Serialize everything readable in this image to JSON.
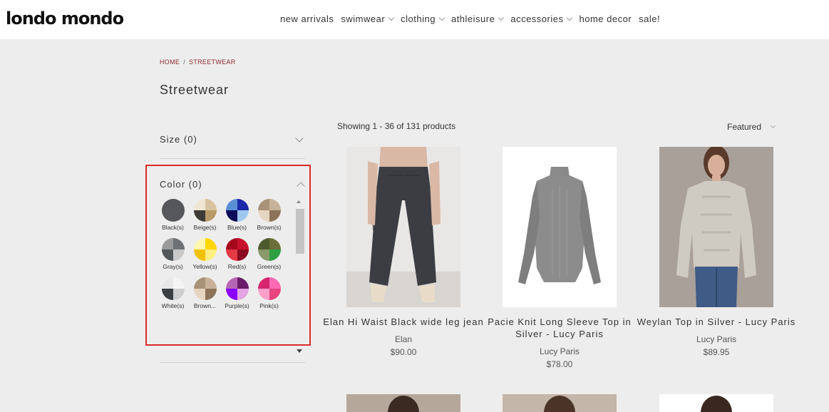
{
  "header": {
    "logo": "londo mondo",
    "nav": [
      {
        "label": "new arrivals",
        "dropdown": false
      },
      {
        "label": "swimwear",
        "dropdown": true
      },
      {
        "label": "clothing",
        "dropdown": true
      },
      {
        "label": "athleisure",
        "dropdown": true
      },
      {
        "label": "accessories",
        "dropdown": true
      },
      {
        "label": "home decor",
        "dropdown": false
      },
      {
        "label": "sale!",
        "dropdown": false
      }
    ]
  },
  "breadcrumb": {
    "home": "HOME",
    "separator": "/",
    "current": "STREETWEAR"
  },
  "page_title": "Streetwear",
  "filters": {
    "size_label": "Size (0)",
    "color_label": "Color (0)",
    "colors": [
      {
        "label": "Black(s)",
        "fills": [
          "#55575a"
        ]
      },
      {
        "label": "Beige(s)",
        "fills": [
          "#d8c2a0",
          "#b89a6a",
          "#3e3a35",
          "#efe6d5"
        ]
      },
      {
        "label": "Blue(s)",
        "fills": [
          "#1b2aa8",
          "#9ec7ef",
          "#0b0b5a",
          "#5a8fd6"
        ]
      },
      {
        "label": "Brown(s)",
        "fills": [
          "#c7b299",
          "#8c735a",
          "#e5d5c0",
          "#a89278"
        ]
      },
      {
        "label": "Gray(s)",
        "fills": [
          "#6e7275",
          "#c9c9c9",
          "#52575a",
          "#9a9a9a"
        ]
      },
      {
        "label": "Yellow(s)",
        "fills": [
          "#ffd500",
          "#ffef80",
          "#f2c200",
          "#fff6b0"
        ]
      },
      {
        "label": "Red(s)",
        "fills": [
          "#c8102e",
          "#8a0a1f",
          "#e63946",
          "#a5081b"
        ]
      },
      {
        "label": "Green(s)",
        "fills": [
          "#6a6f3a",
          "#2ea043",
          "#8a9a6a",
          "#4e5a2e"
        ]
      },
      {
        "label": "White(s)",
        "fills": [
          "#f5f5f5",
          "#cfcfcf",
          "#3a3f44",
          "#e8e8e8"
        ]
      },
      {
        "label": "Brown...",
        "fills": [
          "#c7b299",
          "#8c735a",
          "#e5d5c0",
          "#a89278"
        ]
      },
      {
        "label": "Purple(s)",
        "fills": [
          "#6a1b6a",
          "#e3a6e3",
          "#8b00ff",
          "#b565b5"
        ]
      },
      {
        "label": "Pink(s)",
        "fills": [
          "#ff69b4",
          "#e8437d",
          "#ff9ec8",
          "#d6246e"
        ]
      }
    ]
  },
  "listing": {
    "showing": "Showing 1 - 36 of 131 products",
    "sort": "Featured"
  },
  "products": [
    {
      "name": "Elan Hi Waist Black wide leg jean",
      "brand": "Elan",
      "price": "$90.00"
    },
    {
      "name": "Pacie Knit Long Sleeve Top in Silver - Lucy Paris",
      "brand": "Lucy Paris",
      "price": "$78.00"
    },
    {
      "name": "Weylan Top in Silver - Lucy Paris",
      "brand": "Lucy Paris",
      "price": "$89.95"
    }
  ],
  "colors": {
    "accent": "#8b2b2b",
    "highlight_border": "#d92b2b",
    "background": "#eeeded"
  }
}
